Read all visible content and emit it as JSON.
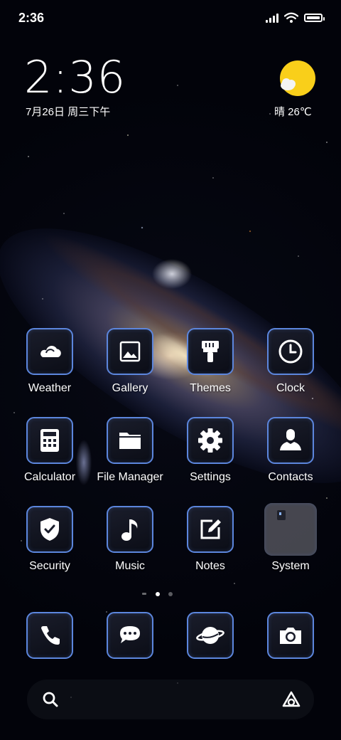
{
  "status_bar": {
    "time": "2:36"
  },
  "widget": {
    "time": "2:36",
    "date": "7月26日 周三下午",
    "temperature": "晴 26℃",
    "weather_icon": "sun-cloud-icon"
  },
  "apps": [
    {
      "label": "Weather",
      "icon": "weather-cloud-icon"
    },
    {
      "label": "Gallery",
      "icon": "image-icon"
    },
    {
      "label": "Themes",
      "icon": "paintbrush-icon"
    },
    {
      "label": "Clock",
      "icon": "clock-icon"
    },
    {
      "label": "Calculator",
      "icon": "calculator-icon"
    },
    {
      "label": "File Manager",
      "icon": "folder-icon"
    },
    {
      "label": "Settings",
      "icon": "gear-icon"
    },
    {
      "label": "Contacts",
      "icon": "person-icon"
    },
    {
      "label": "Security",
      "icon": "shield-check-icon"
    },
    {
      "label": "Music",
      "icon": "music-note-icon"
    },
    {
      "label": "Notes",
      "icon": "edit-note-icon"
    },
    {
      "label": "System",
      "icon": "folder-preview-icon"
    }
  ],
  "dock": [
    {
      "icon": "phone-icon"
    },
    {
      "icon": "message-icon"
    },
    {
      "icon": "planet-browser-icon"
    },
    {
      "icon": "camera-icon"
    }
  ],
  "page_indicator": {
    "pages": 2,
    "current": 1
  },
  "search_bar": {
    "left_icon": "search-icon",
    "right_icon": "app-vault-icon"
  },
  "colors": {
    "tile_border": "#5c86dd",
    "sun": "#f9cf1a"
  }
}
